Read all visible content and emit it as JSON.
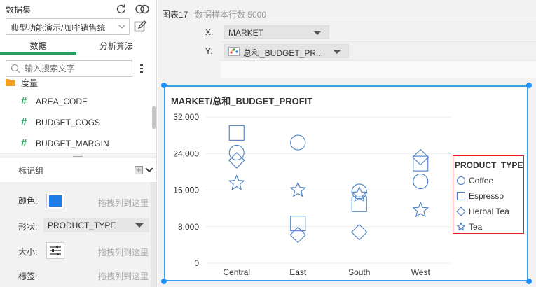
{
  "dataset": {
    "title": "数据集",
    "selected": "典型功能演示/咖啡销售统",
    "refresh_icon": "refresh-icon",
    "link_icon": "link-icon",
    "edit_icon": "edit-icon"
  },
  "tabs": [
    {
      "label": "数据",
      "active": true
    },
    {
      "label": "分析算法",
      "active": false
    }
  ],
  "search": {
    "placeholder": "输入搜索文字"
  },
  "fields": {
    "folder_label": "度量",
    "items": [
      "AREA_CODE",
      "BUDGET_COGS",
      "BUDGET_MARGIN"
    ]
  },
  "marks": {
    "title": "标记组",
    "rows": [
      {
        "label": "颜色:",
        "drop": "拖拽列到这里"
      },
      {
        "label": "形状:",
        "value": "PRODUCT_TYPE"
      },
      {
        "label": "大小:",
        "drop": "拖拽列到这里"
      },
      {
        "label": "标签:",
        "drop": "拖拽列到这里"
      }
    ],
    "color_value": "#1e7de6"
  },
  "chart_header": {
    "name": "图表17",
    "sample_count": "数据样本行数 5000"
  },
  "axes": {
    "x": {
      "label": "X:",
      "field": "MARKET"
    },
    "y": {
      "label": "Y:",
      "field": "总和_BUDGET_PR..."
    }
  },
  "accent": "#3ba0e6",
  "chart_data": {
    "type": "scatter",
    "title": "MARKET/总和_BUDGET_PROFIT",
    "xlabel": "",
    "ylabel": "",
    "categories": [
      "Central",
      "East",
      "South",
      "West"
    ],
    "ylim": [
      0,
      32000
    ],
    "yticks": [
      0,
      8000,
      16000,
      24000,
      32000
    ],
    "ytick_labels": [
      "0",
      "8,000",
      "16,000",
      "24,000",
      "32,000"
    ],
    "grid": true,
    "legend": {
      "title": "PRODUCT_TYPE",
      "placement": "right"
    },
    "marker_color": "#4a7fc1",
    "series": [
      {
        "name": "Coffee",
        "shape": "circle",
        "values": [
          24200,
          26400,
          15700,
          17900
        ]
      },
      {
        "name": "Espresso",
        "shape": "square",
        "values": [
          28500,
          8700,
          12900,
          21800
        ]
      },
      {
        "name": "Herbal Tea",
        "shape": "diamond",
        "values": [
          22500,
          6200,
          6800,
          23200
        ]
      },
      {
        "name": "Tea",
        "shape": "star",
        "values": [
          17500,
          16000,
          15000,
          11600
        ]
      }
    ]
  }
}
